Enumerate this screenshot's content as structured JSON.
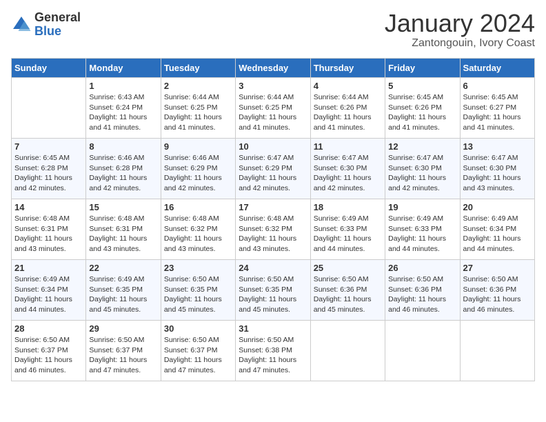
{
  "logo": {
    "text_general": "General",
    "text_blue": "Blue"
  },
  "title": "January 2024",
  "location": "Zantongouin, Ivory Coast",
  "days_of_week": [
    "Sunday",
    "Monday",
    "Tuesday",
    "Wednesday",
    "Thursday",
    "Friday",
    "Saturday"
  ],
  "weeks": [
    [
      {
        "day": "",
        "info": ""
      },
      {
        "day": "1",
        "info": "Sunrise: 6:43 AM\nSunset: 6:24 PM\nDaylight: 11 hours\nand 41 minutes."
      },
      {
        "day": "2",
        "info": "Sunrise: 6:44 AM\nSunset: 6:25 PM\nDaylight: 11 hours\nand 41 minutes."
      },
      {
        "day": "3",
        "info": "Sunrise: 6:44 AM\nSunset: 6:25 PM\nDaylight: 11 hours\nand 41 minutes."
      },
      {
        "day": "4",
        "info": "Sunrise: 6:44 AM\nSunset: 6:26 PM\nDaylight: 11 hours\nand 41 minutes."
      },
      {
        "day": "5",
        "info": "Sunrise: 6:45 AM\nSunset: 6:26 PM\nDaylight: 11 hours\nand 41 minutes."
      },
      {
        "day": "6",
        "info": "Sunrise: 6:45 AM\nSunset: 6:27 PM\nDaylight: 11 hours\nand 41 minutes."
      }
    ],
    [
      {
        "day": "7",
        "info": "Sunrise: 6:45 AM\nSunset: 6:28 PM\nDaylight: 11 hours\nand 42 minutes."
      },
      {
        "day": "8",
        "info": "Sunrise: 6:46 AM\nSunset: 6:28 PM\nDaylight: 11 hours\nand 42 minutes."
      },
      {
        "day": "9",
        "info": "Sunrise: 6:46 AM\nSunset: 6:29 PM\nDaylight: 11 hours\nand 42 minutes."
      },
      {
        "day": "10",
        "info": "Sunrise: 6:47 AM\nSunset: 6:29 PM\nDaylight: 11 hours\nand 42 minutes."
      },
      {
        "day": "11",
        "info": "Sunrise: 6:47 AM\nSunset: 6:30 PM\nDaylight: 11 hours\nand 42 minutes."
      },
      {
        "day": "12",
        "info": "Sunrise: 6:47 AM\nSunset: 6:30 PM\nDaylight: 11 hours\nand 42 minutes."
      },
      {
        "day": "13",
        "info": "Sunrise: 6:47 AM\nSunset: 6:30 PM\nDaylight: 11 hours\nand 43 minutes."
      }
    ],
    [
      {
        "day": "14",
        "info": "Sunrise: 6:48 AM\nSunset: 6:31 PM\nDaylight: 11 hours\nand 43 minutes."
      },
      {
        "day": "15",
        "info": "Sunrise: 6:48 AM\nSunset: 6:31 PM\nDaylight: 11 hours\nand 43 minutes."
      },
      {
        "day": "16",
        "info": "Sunrise: 6:48 AM\nSunset: 6:32 PM\nDaylight: 11 hours\nand 43 minutes."
      },
      {
        "day": "17",
        "info": "Sunrise: 6:48 AM\nSunset: 6:32 PM\nDaylight: 11 hours\nand 43 minutes."
      },
      {
        "day": "18",
        "info": "Sunrise: 6:49 AM\nSunset: 6:33 PM\nDaylight: 11 hours\nand 44 minutes."
      },
      {
        "day": "19",
        "info": "Sunrise: 6:49 AM\nSunset: 6:33 PM\nDaylight: 11 hours\nand 44 minutes."
      },
      {
        "day": "20",
        "info": "Sunrise: 6:49 AM\nSunset: 6:34 PM\nDaylight: 11 hours\nand 44 minutes."
      }
    ],
    [
      {
        "day": "21",
        "info": "Sunrise: 6:49 AM\nSunset: 6:34 PM\nDaylight: 11 hours\nand 44 minutes."
      },
      {
        "day": "22",
        "info": "Sunrise: 6:49 AM\nSunset: 6:35 PM\nDaylight: 11 hours\nand 45 minutes."
      },
      {
        "day": "23",
        "info": "Sunrise: 6:50 AM\nSunset: 6:35 PM\nDaylight: 11 hours\nand 45 minutes."
      },
      {
        "day": "24",
        "info": "Sunrise: 6:50 AM\nSunset: 6:35 PM\nDaylight: 11 hours\nand 45 minutes."
      },
      {
        "day": "25",
        "info": "Sunrise: 6:50 AM\nSunset: 6:36 PM\nDaylight: 11 hours\nand 45 minutes."
      },
      {
        "day": "26",
        "info": "Sunrise: 6:50 AM\nSunset: 6:36 PM\nDaylight: 11 hours\nand 46 minutes."
      },
      {
        "day": "27",
        "info": "Sunrise: 6:50 AM\nSunset: 6:36 PM\nDaylight: 11 hours\nand 46 minutes."
      }
    ],
    [
      {
        "day": "28",
        "info": "Sunrise: 6:50 AM\nSunset: 6:37 PM\nDaylight: 11 hours\nand 46 minutes."
      },
      {
        "day": "29",
        "info": "Sunrise: 6:50 AM\nSunset: 6:37 PM\nDaylight: 11 hours\nand 47 minutes."
      },
      {
        "day": "30",
        "info": "Sunrise: 6:50 AM\nSunset: 6:37 PM\nDaylight: 11 hours\nand 47 minutes."
      },
      {
        "day": "31",
        "info": "Sunrise: 6:50 AM\nSunset: 6:38 PM\nDaylight: 11 hours\nand 47 minutes."
      },
      {
        "day": "",
        "info": ""
      },
      {
        "day": "",
        "info": ""
      },
      {
        "day": "",
        "info": ""
      }
    ]
  ]
}
